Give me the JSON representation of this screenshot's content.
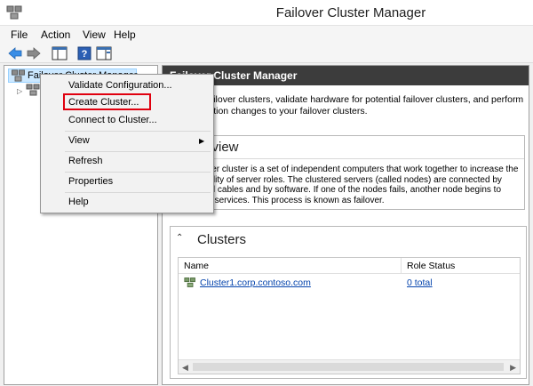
{
  "window": {
    "title": "Failover Cluster Manager"
  },
  "menu": {
    "file": "File",
    "action": "Action",
    "view": "View",
    "help": "Help"
  },
  "tree": {
    "root_label": "Failover Cluster Manager"
  },
  "header": {
    "title": "Failover Cluster Manager"
  },
  "description": "Create failover clusters, validate hardware for potential failover clusters, and perform configuration changes to your failover clusters.",
  "overview": {
    "title": "Overview",
    "text": "A failover cluster is a set of independent computers that work together to increase the availability of server roles. The clustered servers (called nodes) are connected by physical cables and by software. If one of the nodes fails, another node begins to provide services. This process is known as failover."
  },
  "clusters": {
    "title": "Clusters",
    "columns": {
      "name": "Name",
      "role_status": "Role Status"
    },
    "rows": [
      {
        "name": "Cluster1.corp.contoso.com",
        "role_status": "0 total"
      }
    ]
  },
  "context_menu": {
    "items": [
      {
        "label": "Validate Configuration..."
      },
      {
        "label": "Create Cluster..."
      },
      {
        "label": "Connect to Cluster..."
      },
      {
        "label": "View"
      },
      {
        "label": "Refresh"
      },
      {
        "label": "Properties"
      },
      {
        "label": "Help"
      }
    ],
    "highlighted_item": "Create Cluster...",
    "highlight_color": "#e0000f"
  },
  "colors": {
    "header_bg": "#3c3c3c",
    "link": "#0645ad",
    "selection": "#cce8ff"
  },
  "icons": [
    "cluster-manager-icon",
    "back-icon",
    "forward-icon",
    "show-hide-console-tree-icon",
    "help-icon",
    "action-pane-icon",
    "cluster-icon",
    "submenu-arrow-icon",
    "collapse-chevron-icon"
  ]
}
